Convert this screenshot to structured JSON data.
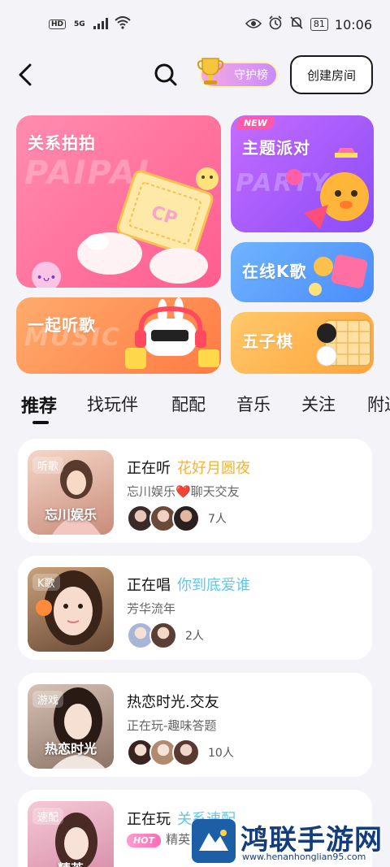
{
  "status_bar": {
    "left_tags": [
      "HD",
      "5G"
    ],
    "battery": "81",
    "time": "10:06"
  },
  "nav": {
    "guard_label": "守护榜",
    "create_label": "创建房间"
  },
  "cards": {
    "paipai": {
      "title": "关系拍拍",
      "ghost": "PAIPAI",
      "ticket": "CP"
    },
    "party": {
      "title": "主题派对",
      "ghost": "PARTY",
      "badge": "NEW"
    },
    "ktv": {
      "title": "在线K歌"
    },
    "music": {
      "title": "一起听歌",
      "ghost": "MUSIC"
    },
    "gomoku": {
      "title": "五子棋"
    }
  },
  "tabs": [
    "推荐",
    "找玩伴",
    "配配",
    "音乐",
    "关注",
    "附近"
  ],
  "rooms": [
    {
      "cover_tag": "听歌",
      "cover_caption": "忘川娱乐",
      "verb": "正在听",
      "song": "花好月圆夜",
      "song_color": "#f2b33d",
      "sub": "忘川娱乐❤️聊天交友",
      "count": "7人"
    },
    {
      "cover_tag": "K歌",
      "verb": "正在唱",
      "song": "你到底爱谁",
      "song_color": "#5fc8ef",
      "sub": "芳华流年",
      "count": "2人"
    },
    {
      "cover_tag": "游戏",
      "cover_caption": "热恋时光",
      "title": "热恋时光.交友",
      "sub": "正在玩-趣味答题",
      "count": "10人"
    },
    {
      "cover_tag": "速配",
      "cover_caption": "精英",
      "verb": "正在玩",
      "song": "关系速配",
      "song_color": "#5fc8ef",
      "badge": "HOT",
      "sub": "精英"
    }
  ],
  "watermark": {
    "title": "鸿联手游网",
    "url": "www.henanhonglian95.com"
  }
}
